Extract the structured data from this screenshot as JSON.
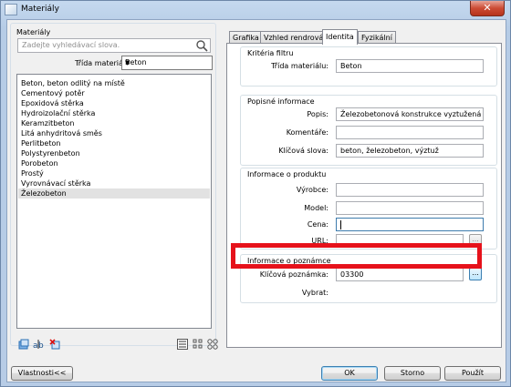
{
  "window": {
    "title": "Materiály",
    "close_glyph": "✕"
  },
  "left": {
    "group_label": "Materiály",
    "search_placeholder": "Zadejte vyhledávací slova.",
    "class_label": "Třída materiálu:",
    "class_value": "Beton",
    "items": [
      "Beton, beton odlitý na místě",
      "Cementový potěr",
      "Epoxidová stěrka",
      "Hydroizolační stěrka",
      "Keramzitbeton",
      "Litá anhydritová směs",
      "Perlitbeton",
      "Polystyrenbeton",
      "Porobeton",
      "Prostý",
      "Vyrovnávací stěrka",
      "Železobeton"
    ],
    "selected_item": "Železobeton",
    "icons": [
      "new-material-icon",
      "rename-icon",
      "delete-material-icon",
      "list-view-icon",
      "small-icons-view-icon",
      "large-icons-view-icon"
    ]
  },
  "tabs": [
    "Grafika",
    "Vzhled rendrování",
    "Identita",
    "Fyzikální"
  ],
  "active_tab": "Identita",
  "filter": {
    "title": "Kritéria filtru",
    "class_label": "Třída materiálu:",
    "class_value": "Beton"
  },
  "description": {
    "title": "Popisné informace",
    "desc_label": "Popis:",
    "desc_value": "Železobetonová konstrukce vyztužená vázanou výztuží",
    "comment_label": "Komentáře:",
    "comment_value": "",
    "keywords_label": "Klíčová slova:",
    "keywords_value": "beton, železobeton, výztuž"
  },
  "product": {
    "title": "Informace o produktu",
    "maker_label": "Výrobce:",
    "maker_value": "",
    "model_label": "Model:",
    "model_value": "",
    "price_label": "Cena:",
    "price_value": "",
    "url_label": "URL:",
    "url_value": "",
    "browse_label": "..."
  },
  "notes": {
    "title": "Informace o poznámce",
    "key_label": "Klíčová poznámka:",
    "key_value": "03300",
    "browse_label": "...",
    "select_label": "Vybrat:"
  },
  "buttons": {
    "properties": "Vlastnosti<<",
    "ok": "OK",
    "cancel": "Storno",
    "apply": "Použít"
  },
  "colors": {
    "highlight": "#e6121b",
    "selection": "#e2e2e2"
  }
}
